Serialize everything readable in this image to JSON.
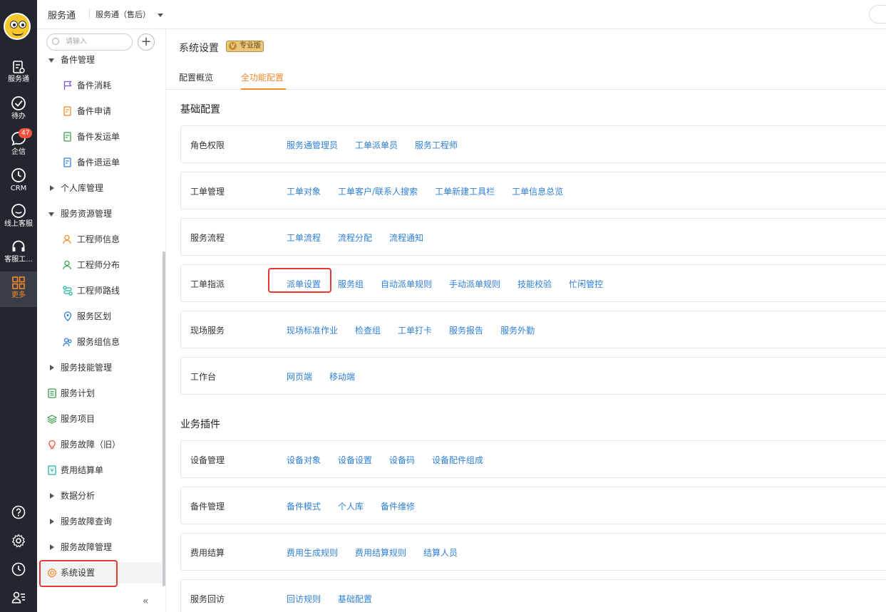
{
  "rail": {
    "items": [
      {
        "label": "服务通",
        "icon": "service-icon"
      },
      {
        "label": "待办",
        "icon": "check-circle-icon"
      },
      {
        "label": "企信",
        "icon": "chat-bubble-icon",
        "badge": "47"
      },
      {
        "label": "CRM",
        "icon": "clock-icon"
      },
      {
        "label": "线上客服",
        "icon": "smile-icon"
      },
      {
        "label": "客服工...",
        "icon": "headset-icon"
      },
      {
        "label": "更多",
        "icon": "grid-icon"
      }
    ],
    "accent": "#f5882a"
  },
  "topbar": {
    "app_title": "服务通",
    "app_select": "服务通（售后）"
  },
  "sidebar": {
    "search_placeholder": "请输入",
    "add_label": "+",
    "items": [
      {
        "label": "备件管理"
      },
      {
        "label": "备件消耗"
      },
      {
        "label": "备件申请"
      },
      {
        "label": "备件发运单"
      },
      {
        "label": "备件退运单"
      },
      {
        "label": "个人库管理"
      },
      {
        "label": "服务资源管理"
      },
      {
        "label": "工程师信息"
      },
      {
        "label": "工程师分布"
      },
      {
        "label": "工程师路线"
      },
      {
        "label": "服务区划"
      },
      {
        "label": "服务组信息"
      },
      {
        "label": "服务技能管理"
      },
      {
        "label": "服务计划"
      },
      {
        "label": "服务项目"
      },
      {
        "label": "服务故障（旧）"
      },
      {
        "label": "费用结算单"
      },
      {
        "label": "数据分析"
      },
      {
        "label": "服务故障查询"
      },
      {
        "label": "服务故障管理"
      },
      {
        "label": "系统设置"
      }
    ],
    "collapse_label": "«"
  },
  "main": {
    "title": "系统设置",
    "pro_tag": "专业版",
    "tabs": [
      {
        "label": "配置概览"
      },
      {
        "label": "全功能配置"
      }
    ],
    "sections": [
      {
        "title": "基础配置",
        "cards": [
          {
            "label": "角色权限",
            "links": [
              "服务通管理员",
              "工单派单员",
              "服务工程师"
            ]
          },
          {
            "label": "工单管理",
            "links": [
              "工单对象",
              "工单客户/联系人搜索",
              "工单新建工具栏",
              "工单信息总览"
            ]
          },
          {
            "label": "服务流程",
            "links": [
              "工单流程",
              "流程分配",
              "流程通知"
            ]
          },
          {
            "label": "工单指派",
            "links": [
              "派单设置",
              "服务组",
              "自动派单规则",
              "手动派单规则",
              "技能校验",
              "忙闲管控"
            ]
          },
          {
            "label": "现场服务",
            "links": [
              "现场标准作业",
              "检查组",
              "工单打卡",
              "服务报告",
              "服务外勤"
            ]
          },
          {
            "label": "工作台",
            "links": [
              "网页端",
              "移动端"
            ]
          }
        ]
      },
      {
        "title": "业务插件",
        "cards": [
          {
            "label": "设备管理",
            "links": [
              "设备对象",
              "设备设置",
              "设备码",
              "设备配件组成"
            ]
          },
          {
            "label": "备件管理",
            "links": [
              "备件模式",
              "个人库",
              "备件维修"
            ]
          },
          {
            "label": "费用结算",
            "links": [
              "费用生成规则",
              "费用结算规则",
              "结算人员"
            ]
          },
          {
            "label": "服务回访",
            "links": [
              "回访规则",
              "基础配置"
            ]
          }
        ]
      }
    ],
    "link_color": "#2e7fd8"
  }
}
